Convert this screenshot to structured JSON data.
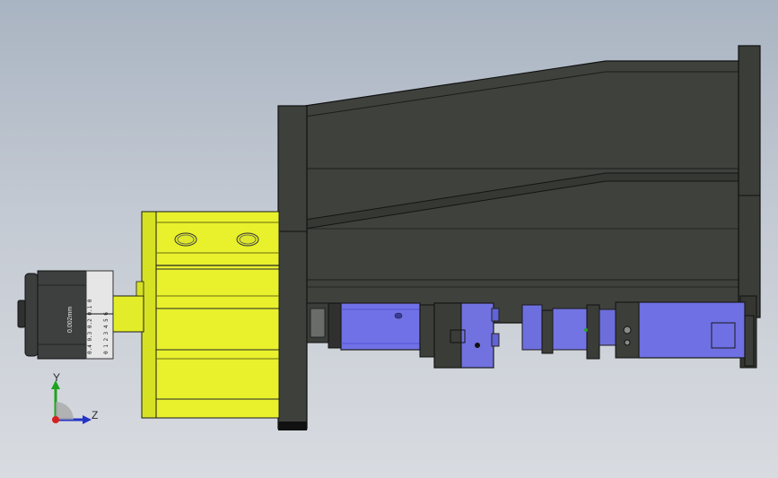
{
  "viewport": {
    "background_top": "#a9b4c2",
    "background_bottom": "#d8dbe0"
  },
  "colors": {
    "frame_dark": "#3e403c",
    "frame_edge": "#1a1a1a",
    "cylinder_yellow": "#e6f02a",
    "motor_blue": "#6e6fe0",
    "micrometer_dark": "#3b3d3d",
    "micrometer_scale": "#e8e8e8"
  },
  "micrometer": {
    "scale_text": "0.002mm",
    "thimble_digits": "0 1 2 3 4 5 6",
    "sleeve_digits": "0.4 0.3 0.2 0.1 0"
  },
  "triad": {
    "y_label": "Y",
    "z_label": "Z",
    "x_icon": "x-axis-arrow",
    "y_icon": "y-axis-arrow",
    "z_icon": "z-axis-arrow"
  }
}
